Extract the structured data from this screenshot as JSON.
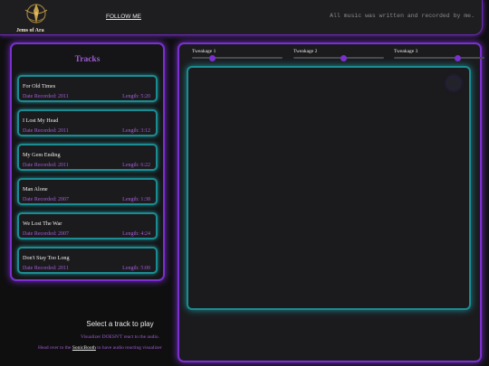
{
  "header": {
    "logo_text": "Jems of Ara",
    "follow_label": "FOLLOW ME",
    "tagline": "All music was written and recorded by me."
  },
  "tracks": {
    "title": "Tracks",
    "items": [
      {
        "name": "For Old Times",
        "date": "Date Recorded: 2011",
        "length": "Length: 5:20"
      },
      {
        "name": "I Lost My Head",
        "date": "Date Recorded: 2011",
        "length": "Length: 3:12"
      },
      {
        "name": "My Gem Ending",
        "date": "Date Recorded: 2011",
        "length": "Length: 6:22"
      },
      {
        "name": "Man Alone",
        "date": "Date Recorded: 2007",
        "length": "Length: 1:38"
      },
      {
        "name": "We Lost The War",
        "date": "Date Recorded: 2007",
        "length": "Length: 4:24"
      },
      {
        "name": "Don't Stay Too Long",
        "date": "Date Recorded: 2011",
        "length": "Length: 5:00"
      }
    ]
  },
  "footer": {
    "select_prompt": "Select a track to play",
    "note1": "Visualizer DOESN'T react to the audio.",
    "note2_prefix": "Head over to the ",
    "note2_link": "SonicBooth",
    "note2_suffix": " to have audio reacting visualizer"
  },
  "visualizer": {
    "tweaks": [
      {
        "label": "Tweakage 1",
        "value": 0.22
      },
      {
        "label": "Tweakage 2",
        "value": 0.55
      },
      {
        "label": "Tweakage 3",
        "value": 0.7
      }
    ]
  },
  "colors": {
    "accent_purple": "#7b2fd0",
    "accent_teal": "#1b8c92",
    "text_purple": "#a45bd6"
  }
}
